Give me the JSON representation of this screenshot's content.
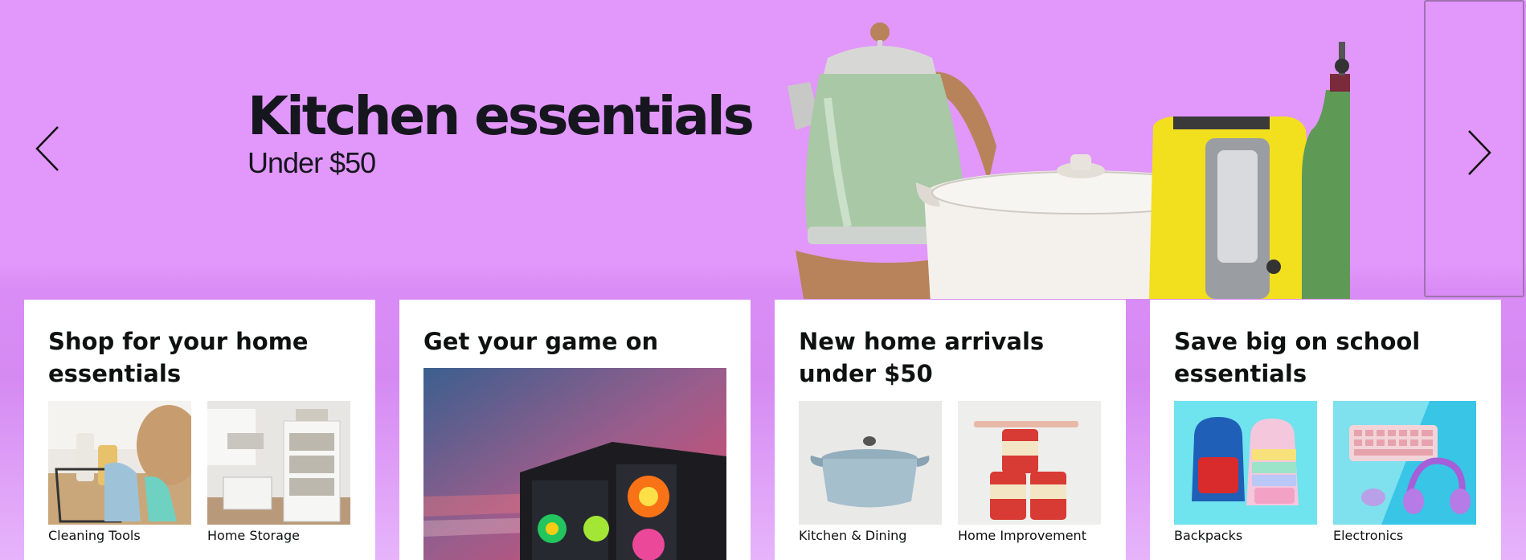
{
  "hero": {
    "title": "Kitchen essentials",
    "subtitle": "Under $50",
    "background_color": "#e297fb",
    "prev_icon": "chevron-left-icon",
    "next_icon": "chevron-right-icon"
  },
  "cards": [
    {
      "title": "Shop for your home essentials",
      "tiles": [
        {
          "label": "Cleaning Tools"
        },
        {
          "label": "Home Storage"
        }
      ]
    },
    {
      "title": "Get your game on"
    },
    {
      "title": "New home arrivals under $50",
      "tiles": [
        {
          "label": "Kitchen & Dining"
        },
        {
          "label": "Home Improvement"
        }
      ]
    },
    {
      "title": "Save big on school essentials",
      "tiles": [
        {
          "label": "Backpacks"
        },
        {
          "label": "Electronics"
        }
      ]
    }
  ]
}
